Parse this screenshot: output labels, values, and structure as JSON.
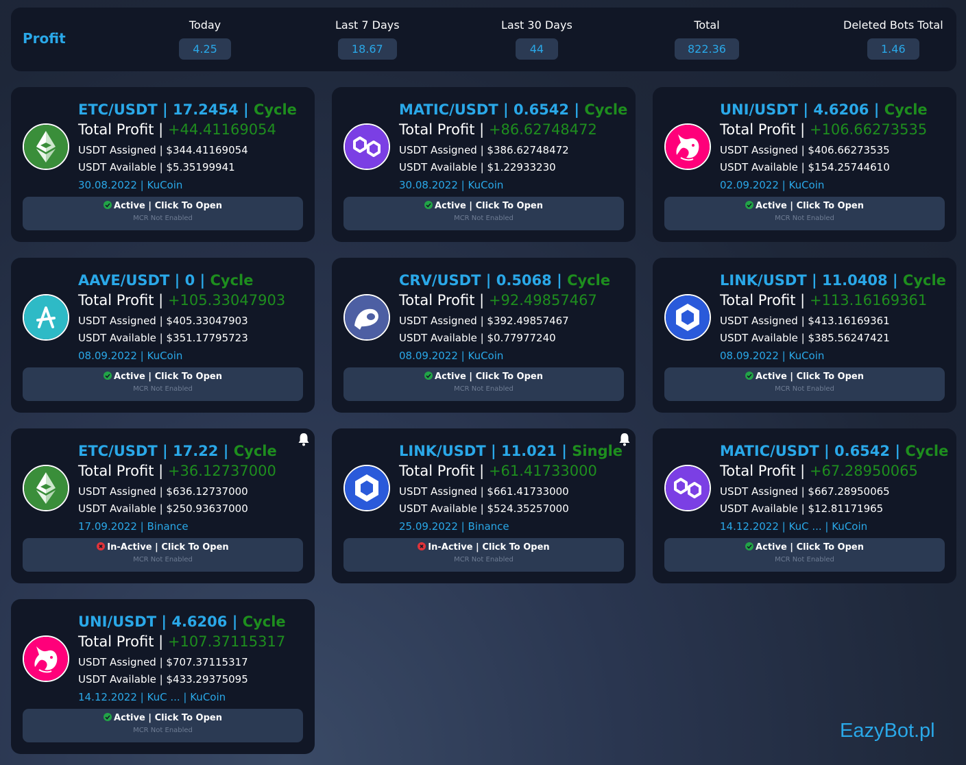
{
  "header": {
    "title": "Profit",
    "stats": [
      {
        "label": "Today",
        "value": "4.25"
      },
      {
        "label": "Last 7 Days",
        "value": "18.67"
      },
      {
        "label": "Last 30 Days",
        "value": "44"
      },
      {
        "label": "Total",
        "value": "822.36"
      },
      {
        "label": "Deleted Bots Total",
        "value": "1.46"
      }
    ]
  },
  "common": {
    "sep": " | ",
    "total_profit_label": "Total Profit",
    "assigned_label": "USDT Assigned",
    "available_label": "USDT Available",
    "click_label": "Click To Open",
    "mcr_label": "MCR Not Enabled"
  },
  "bots": [
    {
      "pair": "ETC/USDT",
      "price": "17.2454",
      "mode": "Cycle",
      "profit": "+44.41169054",
      "assigned": "$344.41169054",
      "available": "$5.35199941",
      "date": "30.08.2022",
      "exchange": "KuCoin",
      "status": "Active",
      "coin_icon": "ethereum-classic-icon",
      "bell": false
    },
    {
      "pair": "MATIC/USDT",
      "price": "0.6542",
      "mode": "Cycle",
      "profit": "+86.62748472",
      "assigned": "$386.62748472",
      "available": "$1.22933230",
      "date": "30.08.2022",
      "exchange": "KuCoin",
      "status": "Active",
      "coin_icon": "polygon-icon",
      "bell": false
    },
    {
      "pair": "UNI/USDT",
      "price": "4.6206",
      "mode": "Cycle",
      "profit": "+106.66273535",
      "assigned": "$406.66273535",
      "available": "$154.25744610",
      "date": "02.09.2022",
      "exchange": "KuCoin",
      "status": "Active",
      "coin_icon": "uniswap-icon",
      "bell": false
    },
    {
      "pair": "AAVE/USDT",
      "price": "0",
      "mode": "Cycle",
      "profit": "+105.33047903",
      "assigned": "$405.33047903",
      "available": "$351.17795723",
      "date": "08.09.2022",
      "exchange": "KuCoin",
      "status": "Active",
      "coin_icon": "aave-icon",
      "bell": false
    },
    {
      "pair": "CRV/USDT",
      "price": "0.5068",
      "mode": "Cycle",
      "profit": "+92.49857467",
      "assigned": "$392.49857467",
      "available": "$0.77977240",
      "date": "08.09.2022",
      "exchange": "KuCoin",
      "status": "Active",
      "coin_icon": "curve-icon",
      "bell": false
    },
    {
      "pair": "LINK/USDT",
      "price": "11.0408",
      "mode": "Cycle",
      "profit": "+113.16169361",
      "assigned": "$413.16169361",
      "available": "$385.56247421",
      "date": "08.09.2022",
      "exchange": "KuCoin",
      "status": "Active",
      "coin_icon": "chainlink-icon",
      "bell": false
    },
    {
      "pair": "ETC/USDT",
      "price": "17.22",
      "mode": "Cycle",
      "profit": "+36.12737000",
      "assigned": "$636.12737000",
      "available": "$250.93637000",
      "date": "17.09.2022",
      "exchange": "Binance",
      "status": "In-Active",
      "coin_icon": "ethereum-classic-icon",
      "bell": true
    },
    {
      "pair": "LINK/USDT",
      "price": "11.021",
      "mode": "Single",
      "profit": "+61.41733000",
      "assigned": "$661.41733000",
      "available": "$524.35257000",
      "date": "25.09.2022",
      "exchange": "Binance",
      "status": "In-Active",
      "coin_icon": "chainlink-icon",
      "bell": true
    },
    {
      "pair": "MATIC/USDT",
      "price": "0.6542",
      "mode": "Cycle",
      "profit": "+67.28950065",
      "assigned": "$667.28950065",
      "available": "$12.81171965",
      "date": "14.12.2022",
      "exchange": "KuC ... | KuCoin",
      "status": "Active",
      "coin_icon": "polygon-icon",
      "bell": false
    },
    {
      "pair": "UNI/USDT",
      "price": "4.6206",
      "mode": "Cycle",
      "profit": "+107.37115317",
      "assigned": "$707.37115317",
      "available": "$433.29375095",
      "date": "14.12.2022",
      "exchange": "KuC ... | KuCoin",
      "status": "Active",
      "coin_icon": "uniswap-icon",
      "bell": false
    }
  ],
  "colors": {
    "accent": "#2aa8e8",
    "profit": "#1e8e1e",
    "card": "#111726",
    "panel": "#2b3a53"
  },
  "brand": "EazyBot.pl"
}
